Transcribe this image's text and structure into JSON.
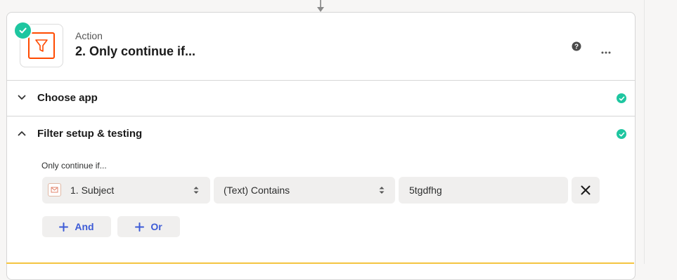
{
  "step": {
    "kind": "Action",
    "title": "2. Only continue if..."
  },
  "sections": {
    "choose_app": "Choose app",
    "filter": "Filter setup & testing"
  },
  "filter": {
    "heading": "Only continue if...",
    "field": "1. Subject",
    "operator": "(Text) Contains",
    "value": "5tgdfhg"
  },
  "buttons": {
    "and": "And",
    "or": "Or"
  },
  "colors": {
    "accent": "#3d5bd6",
    "success": "#1ec6a0",
    "brand": "#ff4a00"
  },
  "icons": {
    "app": "filter-icon",
    "status": "check-icon",
    "help": "help-icon",
    "more": "more-icon",
    "field_source": "gmail-icon",
    "remove": "close-icon"
  }
}
